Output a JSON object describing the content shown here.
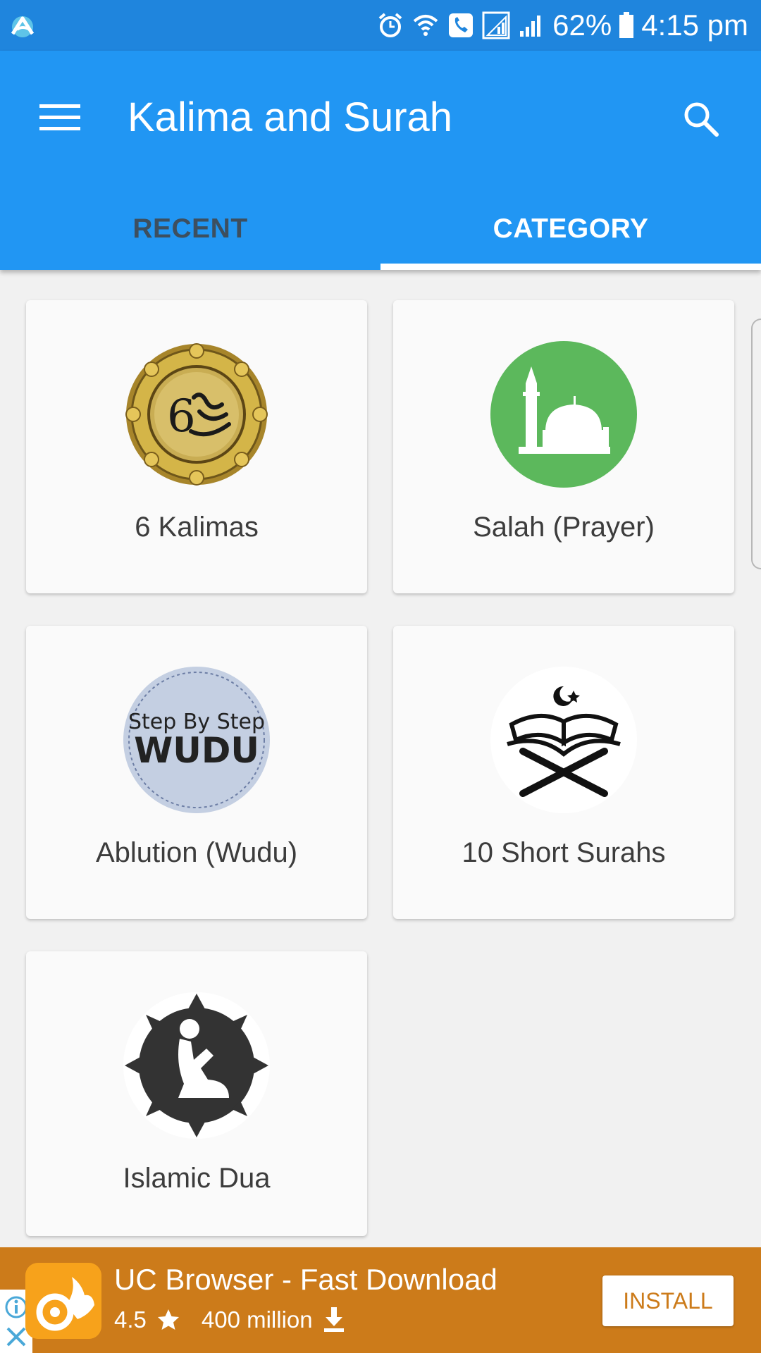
{
  "status_bar": {
    "battery": "62%",
    "time": "4:15 pm",
    "icons": [
      "app-logo-icon",
      "alarm-icon",
      "wifi-icon",
      "call-icon",
      "signal-icon",
      "signal-icon",
      "battery-icon"
    ]
  },
  "app_bar": {
    "title": "Kalima and Surah",
    "menu_icon": "menu-icon",
    "search_icon": "search-icon"
  },
  "tabs": [
    {
      "label": "RECENT",
      "selected": false
    },
    {
      "label": "CATEGORY",
      "selected": true
    }
  ],
  "categories": [
    {
      "label": "6 Kalimas",
      "icon": "kalimas-seal-icon"
    },
    {
      "label": "Salah (Prayer)",
      "icon": "mosque-icon"
    },
    {
      "label": "Ablution (Wudu)",
      "icon": "wudu-badge-icon",
      "badge_text_1": "Step By Step",
      "badge_text_2": "WUDU"
    },
    {
      "label": "10 Short Surahs",
      "icon": "quran-stand-icon"
    },
    {
      "label": "Islamic Dua",
      "icon": "praying-person-icon"
    }
  ],
  "ad": {
    "title": "UC Browser - Fast Download",
    "rating": "4.5",
    "downloads": "400 million",
    "install_label": "INSTALL",
    "colors": {
      "background": "#cc7b1a",
      "icon": "#f7a21b"
    }
  },
  "colors": {
    "status_bar": "#1f85dd",
    "app_bar": "#2196f3",
    "tab_inactive": "#3d4f5f",
    "page_bg": "#f1f1f1"
  }
}
